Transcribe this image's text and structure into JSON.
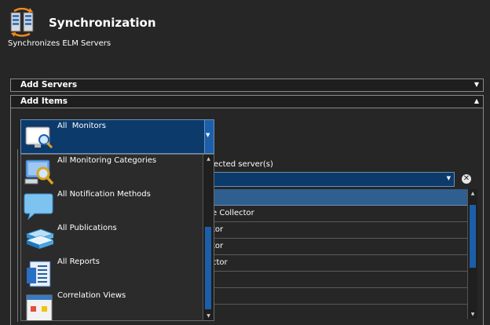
{
  "header": {
    "title": "Synchronization",
    "subtitle": "Synchronizes ELM Servers",
    "icon": "servers-sync-icon"
  },
  "panels": {
    "add_servers": {
      "label": "Add Servers",
      "arrow": "▼"
    },
    "add_items": {
      "label": "Add Items",
      "arrow": "▲"
    }
  },
  "item_type_combo": {
    "selected": "All  Monitors",
    "arrow": "▼"
  },
  "item_type_options": [
    {
      "label": "All Monitoring Categories",
      "icon": "monitor-magnifier-icon"
    },
    {
      "label": "All Notification Methods",
      "icon": "speech-bubble-icon"
    },
    {
      "label": "All Publications",
      "icon": "books-icon"
    },
    {
      "label": "All Reports",
      "icon": "report-document-icon"
    },
    {
      "label": "Correlation Views",
      "icon": "correlation-view-icon"
    }
  ],
  "servers_section": {
    "label_partial": "ected server(s)",
    "clear_symbol": "✕"
  },
  "items_grid": {
    "rows": [
      "e Collector",
      "tor",
      "tor",
      "ctor",
      "",
      "",
      ""
    ]
  },
  "colors": {
    "accent": "#0c3a6b",
    "scroll_thumb": "#1b5fa8",
    "background": "#262626"
  }
}
